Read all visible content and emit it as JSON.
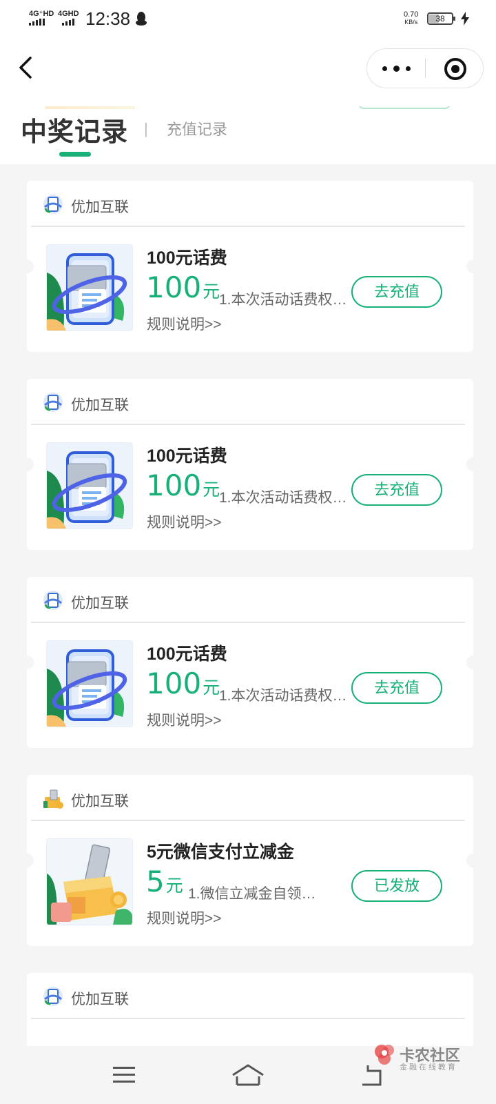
{
  "status_bar": {
    "network_1": "4G⁺HD",
    "network_2": "4GHD",
    "time": "12:38",
    "speed_value": "0.70",
    "speed_unit": "KB/s",
    "battery": "38"
  },
  "tabs": {
    "active": "中奖记录",
    "separator": "|",
    "inactive": "充值记录"
  },
  "cards": [
    {
      "merchant": "优加互联",
      "title": "100元话费",
      "amount": "100",
      "unit": "元",
      "description": "1.本次活动话费权…",
      "rules": "规则说明>>",
      "action": "去充值",
      "image": "phone-bill-card"
    },
    {
      "merchant": "优加互联",
      "title": "100元话费",
      "amount": "100",
      "unit": "元",
      "description": "1.本次活动话费权…",
      "rules": "规则说明>>",
      "action": "去充值",
      "image": "phone-bill-card"
    },
    {
      "merchant": "优加互联",
      "title": "100元话费",
      "amount": "100",
      "unit": "元",
      "description": "1.本次活动话费权…",
      "rules": "规则说明>>",
      "action": "去充值",
      "image": "phone-bill-card"
    },
    {
      "merchant": "优加互联",
      "title": "5元微信支付立减金",
      "amount": "5",
      "unit": "元",
      "description": "1.微信立减金自领…",
      "rules": "规则说明>>",
      "action": "已发放",
      "image": "coin-box"
    },
    {
      "merchant": "优加互联"
    }
  ],
  "watermark": {
    "title": "卡农社区",
    "subtitle": "金融在线教育"
  },
  "colors": {
    "accent": "#17b077",
    "background": "#f5f5f5",
    "card": "#ffffff"
  }
}
